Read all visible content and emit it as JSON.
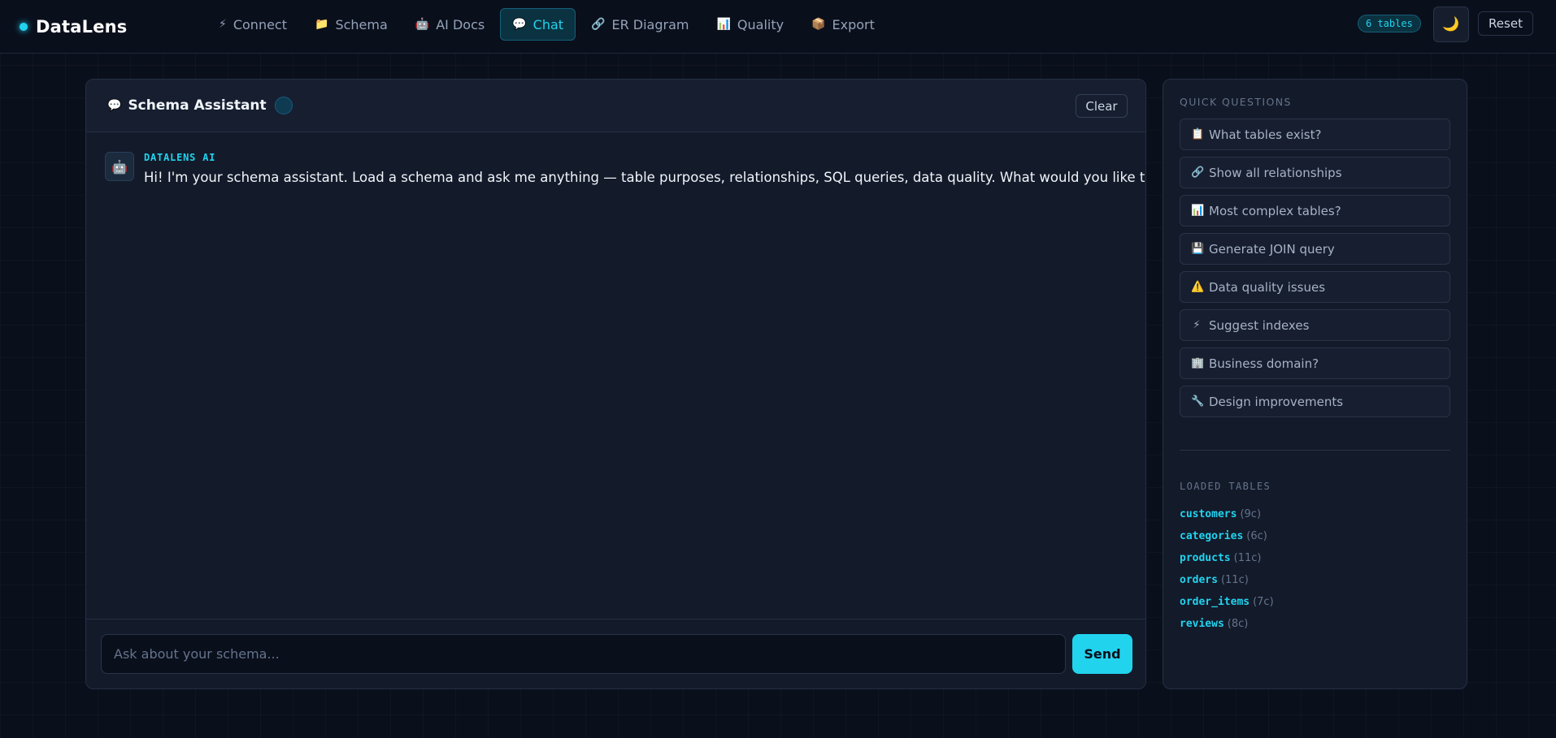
{
  "brand": {
    "name": "DataLens"
  },
  "nav": {
    "tabs": [
      {
        "label": "Connect",
        "icon": "lightning-icon",
        "glyph": "⚡"
      },
      {
        "label": "Schema",
        "icon": "folder-icon",
        "glyph": "📁"
      },
      {
        "label": "AI Docs",
        "icon": "robot-icon",
        "glyph": "🤖"
      },
      {
        "label": "Chat",
        "icon": "speech-bubble-icon",
        "glyph": "💬",
        "active": true
      },
      {
        "label": "ER Diagram",
        "icon": "link-icon",
        "glyph": "🔗"
      },
      {
        "label": "Quality",
        "icon": "bar-chart-icon",
        "glyph": "📊"
      },
      {
        "label": "Export",
        "icon": "package-icon",
        "glyph": "📦"
      }
    ]
  },
  "header_controls": {
    "tables_badge": "6 tables",
    "theme_glyph": "🌙",
    "reset_label": "Reset"
  },
  "chat": {
    "title": "Schema Assistant",
    "title_glyph": "💬",
    "clear_label": "Clear",
    "messages": [
      {
        "sender": "DATALENS AI",
        "avatar_glyph": "🤖",
        "text": "Hi! I'm your schema assistant. Load a schema and ask me anything — table purposes, relationships, SQL queries, data quality. What would you like to know?"
      }
    ],
    "input_placeholder": "Ask about your schema...",
    "input_value": "",
    "send_label": "Send"
  },
  "sidebar": {
    "quick_questions_label": "QUICK QUESTIONS",
    "quick_questions": [
      {
        "glyph": "📋",
        "icon": "clipboard-icon",
        "label": "What tables exist?"
      },
      {
        "glyph": "🔗",
        "icon": "link-icon",
        "label": "Show all relationships"
      },
      {
        "glyph": "📊",
        "icon": "bar-chart-icon",
        "label": "Most complex tables?"
      },
      {
        "glyph": "💾",
        "icon": "floppy-disk-icon",
        "label": "Generate JOIN query"
      },
      {
        "glyph": "⚠️",
        "icon": "warning-icon",
        "label": "Data quality issues"
      },
      {
        "glyph": "⚡",
        "icon": "lightning-icon",
        "label": "Suggest indexes"
      },
      {
        "glyph": "🏢",
        "icon": "building-icon",
        "label": "Business domain?"
      },
      {
        "glyph": "🔧",
        "icon": "wrench-icon",
        "label": "Design improvements"
      }
    ],
    "loaded_tables_label": "LOADED TABLES",
    "loaded_tables": [
      {
        "name": "customers",
        "cols": "(9c)"
      },
      {
        "name": "categories",
        "cols": "(6c)"
      },
      {
        "name": "products",
        "cols": "(11c)"
      },
      {
        "name": "orders",
        "cols": "(11c)"
      },
      {
        "name": "order_items",
        "cols": "(7c)"
      },
      {
        "name": "reviews",
        "cols": "(8c)"
      }
    ]
  },
  "colors": {
    "accent": "#22d3ee",
    "background": "#0a0f1c",
    "panel": "#131a2a"
  }
}
